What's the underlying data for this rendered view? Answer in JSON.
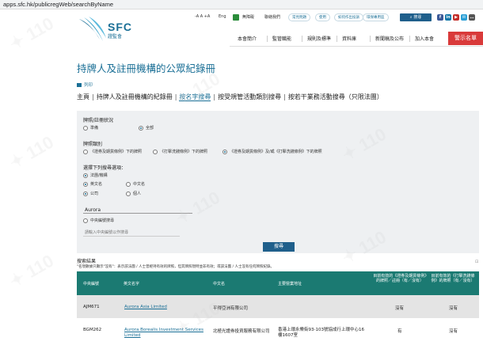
{
  "browser": {
    "url": "apps.sfc.hk/publicregWeb/searchByName"
  },
  "header": {
    "logo_text": "SFC",
    "logo_zh": "證監會",
    "font_size_controls": "-A  A  +A",
    "lang": "Eng",
    "access": "無障礙",
    "contact": "聯絡我們",
    "pills": [
      "常見問題",
      "使用",
      "如何作出投訴",
      "環保專用區"
    ],
    "search_label": "搜尋",
    "social": [
      "f",
      "in",
      "▶",
      "✉",
      "…"
    ]
  },
  "main_nav": [
    "本會簡介",
    "監管職能",
    "規則及標準",
    "資料庫",
    "新聞稿及公布",
    "加入本會"
  ],
  "warning_button": "警示名單",
  "page_title": "持牌人及註冊機構的公眾紀錄冊",
  "print_label": "列印",
  "tabs": {
    "home": "主頁",
    "register": "持牌人及註冊機構的紀錄冊",
    "by_name": "按名字搜尋",
    "by_type": "按受規管活動類別搜尋",
    "by_gifted": "按若干業務活動搜尋（只限法團）"
  },
  "form": {
    "status_label": "牌照/註冊狀況",
    "status_opts": [
      "準備",
      "全部"
    ],
    "category_label": "牌照類別",
    "category_opts": [
      "《證券及期貨條例》下的牌照",
      "《打擊洗錢條例》下的牌照",
      "《證券及期貨條例》及/或《打擊洗錢條例》下的牌照"
    ],
    "role_label": "選擇下列搜尋選項：",
    "role_opts": [
      "法團/機構",
      "英文名",
      "中文名",
      "公司",
      "個人"
    ],
    "name_value": "Aurora",
    "centre_opt": "中央編號搜尋",
    "centre_placeholder": "請輸入中央編號以作搜尋",
    "submit": "搜尋"
  },
  "results": {
    "label": "搜索結果",
    "note": "\"名現數據只顯示\"沒有\"：表示該法團 / 人士曾經持有效的牌照，但其牌照現時並非有效；或該法團 / 人士沒有任何牌照紀錄。",
    "headers": [
      "中央編號",
      "英文名字",
      "中文名",
      "主要營業地址",
      "目前有效的《證券及期貨條例》的牌照／註冊（有／沒有）",
      "目前有效的《打擊洗錢條例》的牌照（有／沒有）"
    ],
    "rows": [
      {
        "ce": "AJM671",
        "en": "Aurora Asia Limited",
        "zh": "平得亞洲有限公司",
        "addr": "",
        "sfo": "沒有",
        "amlo": "沒有"
      },
      {
        "ce": "BGM262",
        "en": "Aurora Borealis Investment Services Limited",
        "zh": "北極光證券投資服務有限公司",
        "addr": "香港上環永樂街93-103號協成行上環中心16樓1607室",
        "sfo": "有",
        "amlo": "沒有"
      }
    ]
  },
  "colors": {
    "brand": "#1a6f96",
    "table_head": "#1b7a72",
    "warning": "#d93a3a"
  }
}
